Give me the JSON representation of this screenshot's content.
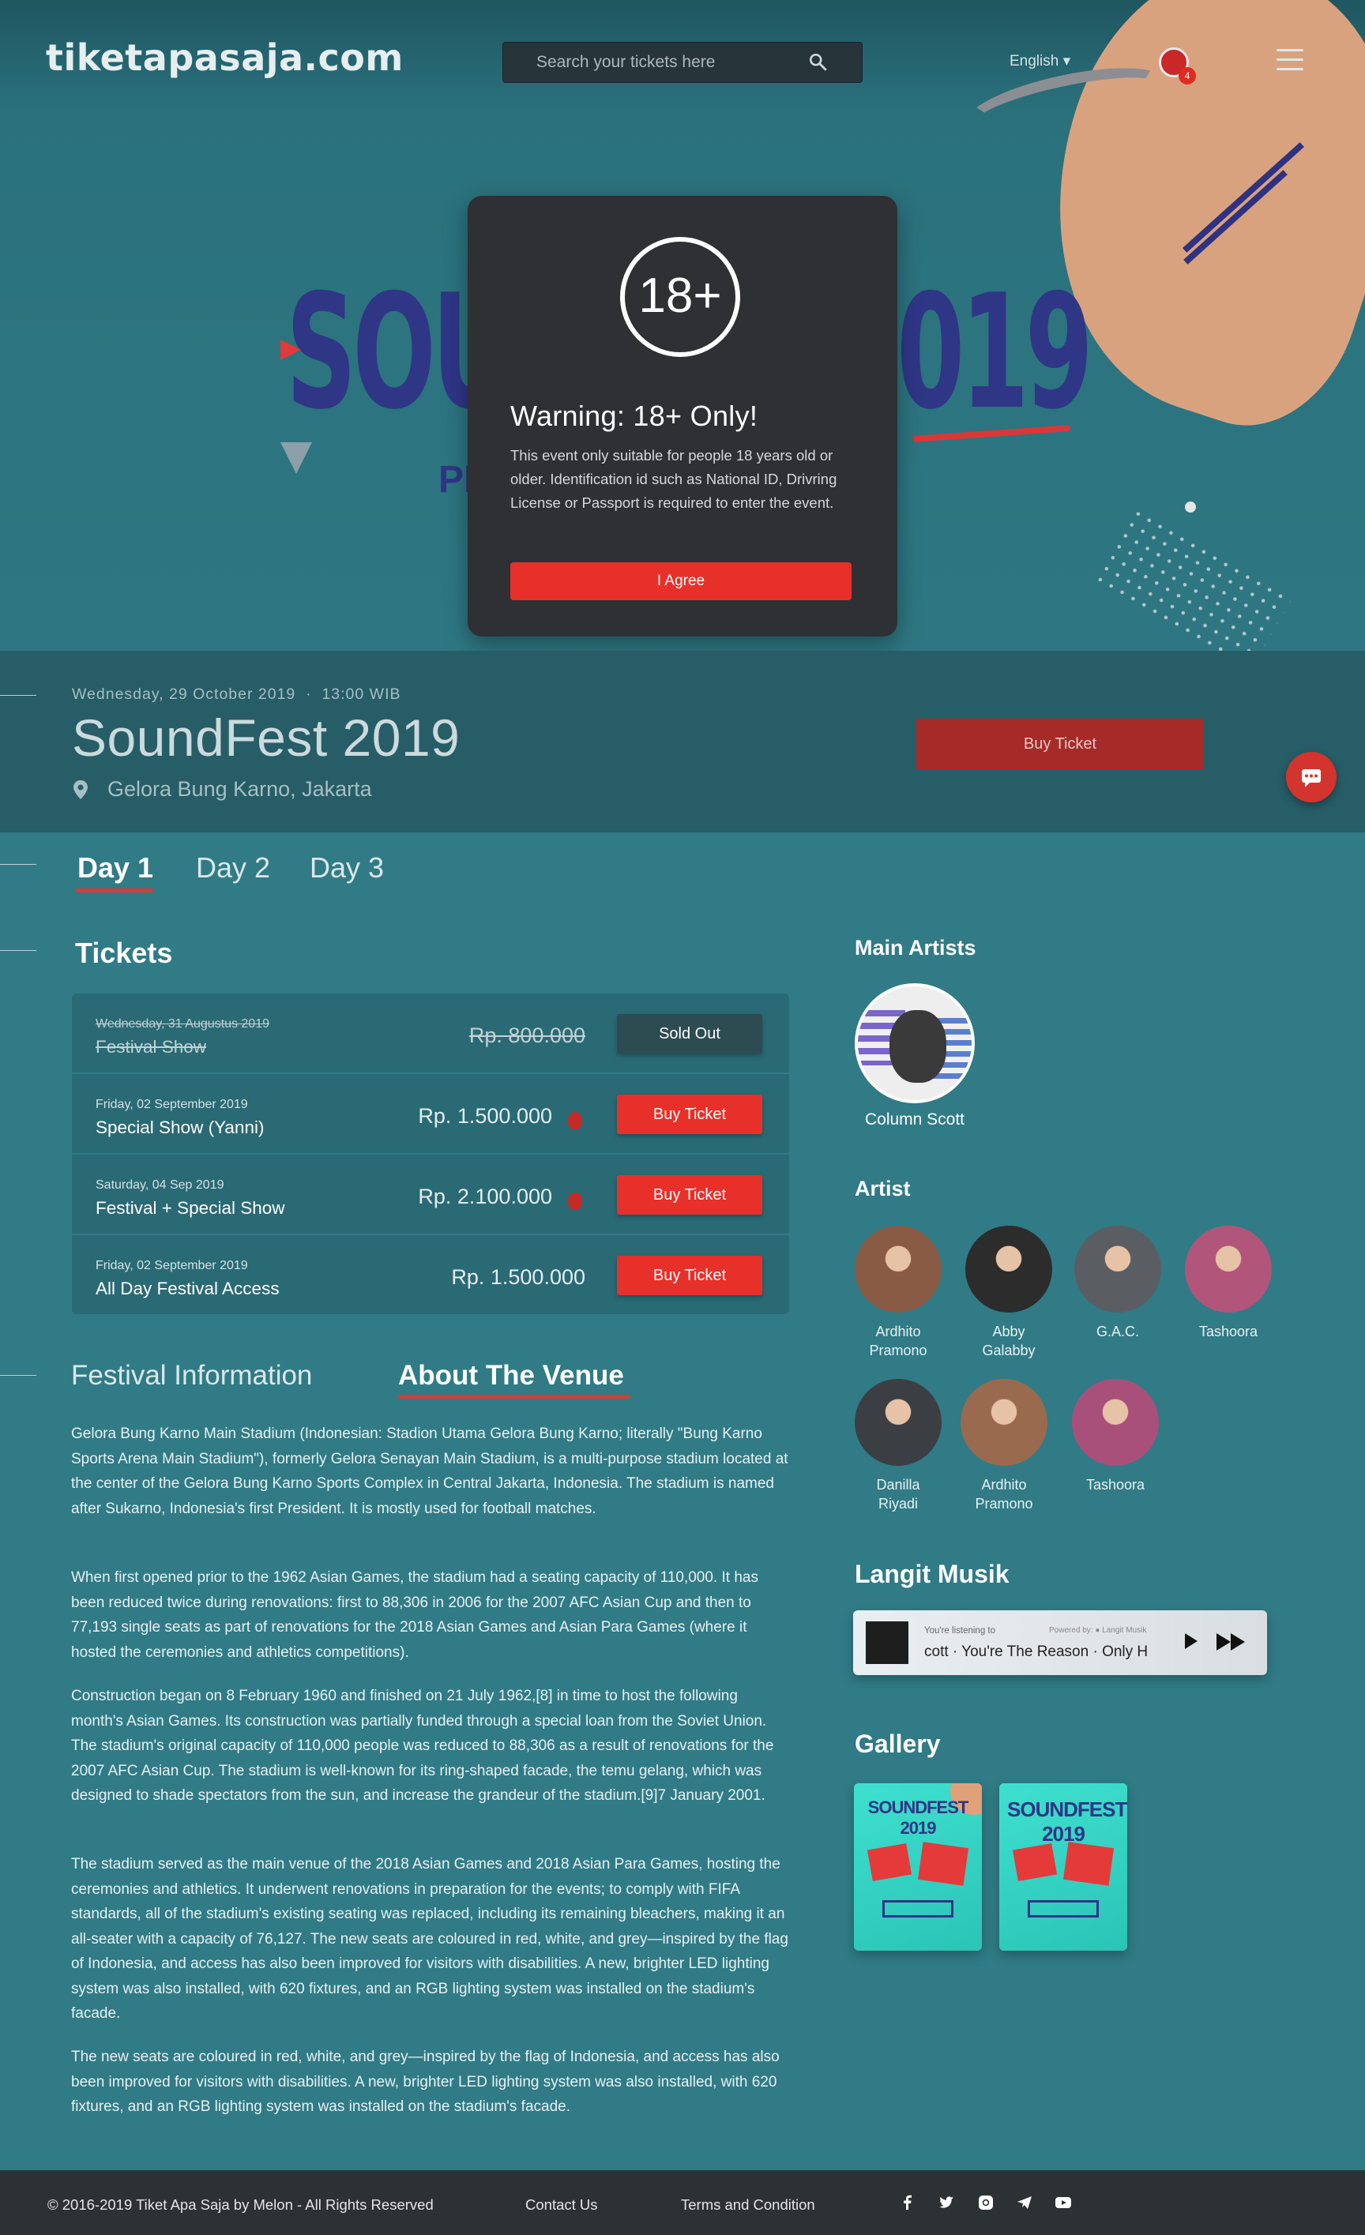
{
  "header": {
    "logo": "tiketapasaja.com",
    "search_placeholder": "Search your tickets here",
    "language": "English ▾",
    "notifications": "4"
  },
  "hero": {
    "title_left": "SOU",
    "title_right": "019",
    "sub": "PI"
  },
  "modal": {
    "badge": "18+",
    "title": "Warning: 18+ Only!",
    "body": "This event only suitable for people 18 years old or older. Identification id such as National ID, Drivring License or Passport is required to enter the event.",
    "button": "I Agree"
  },
  "event": {
    "date": "Wednesday, 29 October 2019",
    "time": "13:00 WIB",
    "title": "SoundFest 2019",
    "location": "Gelora Bung Karno, Jakarta",
    "buy_label": "Buy Ticket"
  },
  "days": [
    "Day 1",
    "Day 2",
    "Day 3"
  ],
  "tickets": {
    "title": "Tickets",
    "rows": [
      {
        "date": "Wednesday, 31 Augustus 2019",
        "name": "Festival Show",
        "price": "Rp. 800.000",
        "button": "Sold Out",
        "sold": true
      },
      {
        "date": "Friday, 02 September 2019",
        "name": "Special Show (Yanni)",
        "price": "Rp. 1.500.000",
        "button": "Buy Ticket",
        "hot": true
      },
      {
        "date": "Saturday, 04 Sep 2019",
        "name": "Festival + Special Show",
        "price": "Rp. 2.100.000",
        "button": "Buy Ticket",
        "hot": true
      },
      {
        "date": "Friday, 02 September 2019",
        "name": "All Day Festival Access",
        "price": "Rp. 1.500.000",
        "button": "Buy Ticket"
      }
    ]
  },
  "info_tabs": [
    "Festival Information",
    "About The Venue"
  ],
  "venue_paragraphs": [
    "Gelora Bung Karno Main Stadium (Indonesian: Stadion Utama Gelora Bung Karno; literally \"Bung Karno Sports Arena Main Stadium\"), formerly Gelora Senayan Main Stadium, is a multi-purpose stadium located at the center of the Gelora Bung Karno Sports Complex in Central Jakarta, Indonesia. The stadium is named after Sukarno, Indonesia's first President. It is mostly used for football matches.",
    "When first opened prior to the 1962 Asian Games, the stadium had a seating capacity of 110,000. It has been reduced twice during renovations: first to 88,306 in 2006 for the 2007 AFC Asian Cup and then to 77,193 single seats as part of renovations for the 2018 Asian Games and Asian Para Games (where it hosted the ceremonies and athletics competitions).",
    "Construction began on 8 February 1960 and finished on 21 July 1962,[8] in time to host the following month's Asian Games. Its construction was partially funded through a special loan from the Soviet Union. The stadium's original capacity of 110,000 people was reduced to 88,306 as a result of renovations for the 2007 AFC Asian Cup. The stadium is well-known for its ring-shaped facade, the temu gelang, which was designed to shade spectators from the sun, and increase the grandeur of the stadium.[9]7 January 2001.",
    "The stadium served as the main venue of the 2018 Asian Games and 2018 Asian Para Games, hosting the ceremonies and athletics. It underwent renovations in preparation for the events; to comply with FIFA standards, all of the stadium's existing seating was replaced, including its remaining bleachers, making it an all-seater with a capacity of 76,127. The new seats are coloured in red, white, and grey—inspired by the flag of Indonesia, and access has also been improved for visitors with disabilities. A new, brighter LED lighting system was also installed, with 620 fixtures, and an RGB lighting system was installed on the stadium's facade.",
    "The new seats are coloured in red, white, and grey—inspired by the flag of Indonesia, and access has also been improved for visitors with disabilities. A new, brighter LED lighting system was also installed, with 620 fixtures, and an RGB lighting system was installed on the stadium's facade."
  ],
  "main_artists": {
    "title": "Main Artists",
    "name": "Column Scott"
  },
  "artists": {
    "title": "Artist",
    "items": [
      {
        "name": "Ardhito\nPramono",
        "color": "#8a5b44"
      },
      {
        "name": "Abby\nGalabby",
        "color": "#2c2c2c"
      },
      {
        "name": "G.A.C.",
        "color": "#5a5e63"
      },
      {
        "name": "Tashoora",
        "color": "#b1557a"
      },
      {
        "name": "Danilla\nRiyadi",
        "color": "#3b3f44"
      },
      {
        "name": "Ardhito\nPramono",
        "color": "#9a6a4e"
      },
      {
        "name": "Tashoora",
        "color": "#a9507a"
      }
    ]
  },
  "langit": {
    "title": "Langit Musik",
    "listening": "You're listening to",
    "powered": "Powered by:  ● Langit Musik",
    "song": "cott · You're The Reason · Only H"
  },
  "gallery": {
    "title": "Gallery",
    "items": [
      "SOUNDFEST 2019",
      "SOUNDFEST 2019"
    ]
  },
  "footer": {
    "copyright": "© 2016-2019 Tiket Apa Saja by Melon - All Rights Reserved",
    "contact": "Contact Us",
    "terms": "Terms and Condition"
  }
}
